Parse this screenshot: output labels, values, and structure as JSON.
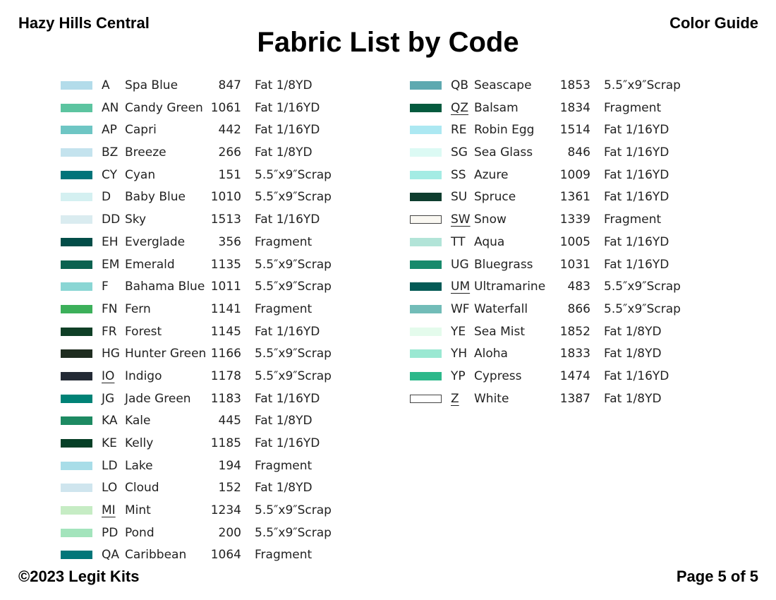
{
  "header": {
    "left": "Hazy Hills Central",
    "right": "Color Guide",
    "title": "Fabric List by Code"
  },
  "footer": {
    "left": "©2023 Legit Kits",
    "right": "Page 5 of 5"
  },
  "columns": [
    [
      {
        "code": "A",
        "name": "Spa Blue",
        "number": "847",
        "cut": "Fat 1/8YD",
        "color": "#b3dcea",
        "underline": false,
        "outline": false
      },
      {
        "code": "AN",
        "name": "Candy Green",
        "number": "1061",
        "cut": "Fat 1/16YD",
        "color": "#5cc4a0",
        "underline": false,
        "outline": false
      },
      {
        "code": "AP",
        "name": "Capri",
        "number": "442",
        "cut": "Fat 1/16YD",
        "color": "#6ec6c4",
        "underline": false,
        "outline": false
      },
      {
        "code": "BZ",
        "name": "Breeze",
        "number": "266",
        "cut": "Fat 1/8YD",
        "color": "#c4e3ee",
        "underline": false,
        "outline": false
      },
      {
        "code": "CY",
        "name": "Cyan",
        "number": "151",
        "cut": "5.5″x9″Scrap",
        "color": "#01747a",
        "underline": false,
        "outline": false
      },
      {
        "code": "D",
        "name": "Baby Blue",
        "number": "1010",
        "cut": "5.5″x9″Scrap",
        "color": "#d4f0f1",
        "underline": false,
        "outline": false
      },
      {
        "code": "DD",
        "name": "Sky",
        "number": "1513",
        "cut": "Fat 1/16YD",
        "color": "#daecf0",
        "underline": false,
        "outline": false
      },
      {
        "code": "EH",
        "name": "Everglade",
        "number": "356",
        "cut": "Fragment",
        "color": "#034d48",
        "underline": false,
        "outline": false
      },
      {
        "code": "EM",
        "name": "Emerald",
        "number": "1135",
        "cut": "5.5″x9″Scrap",
        "color": "#0b6250",
        "underline": false,
        "outline": false
      },
      {
        "code": "F",
        "name": "Bahama Blue",
        "number": "1011",
        "cut": "5.5″x9″Scrap",
        "color": "#8ad6d4",
        "underline": false,
        "outline": false
      },
      {
        "code": "FN",
        "name": "Fern",
        "number": "1141",
        "cut": "Fragment",
        "color": "#3cb05a",
        "underline": false,
        "outline": false
      },
      {
        "code": "FR",
        "name": "Forest",
        "number": "1145",
        "cut": "Fat 1/16YD",
        "color": "#0f3f26",
        "underline": false,
        "outline": false
      },
      {
        "code": "HG",
        "name": "Hunter Green",
        "number": "1166",
        "cut": "5.5″x9″Scrap",
        "color": "#1f2d20",
        "underline": false,
        "outline": false
      },
      {
        "code": "IO",
        "name": "Indigo",
        "number": "1178",
        "cut": "5.5″x9″Scrap",
        "color": "#232a35",
        "underline": true,
        "outline": false
      },
      {
        "code": "JG",
        "name": "Jade Green",
        "number": "1183",
        "cut": "Fat 1/16YD",
        "color": "#008276",
        "underline": false,
        "outline": false
      },
      {
        "code": "KA",
        "name": "Kale",
        "number": "445",
        "cut": "Fat 1/8YD",
        "color": "#1d8a62",
        "underline": false,
        "outline": false
      },
      {
        "code": "KE",
        "name": "Kelly",
        "number": "1185",
        "cut": "Fat 1/16YD",
        "color": "#053f26",
        "underline": false,
        "outline": false
      },
      {
        "code": "LD",
        "name": "Lake",
        "number": "194",
        "cut": "Fragment",
        "color": "#a8dde8",
        "underline": false,
        "outline": false
      },
      {
        "code": "LO",
        "name": "Cloud",
        "number": "152",
        "cut": "Fat 1/8YD",
        "color": "#cfe5ee",
        "underline": false,
        "outline": false
      },
      {
        "code": "MI",
        "name": "Mint",
        "number": "1234",
        "cut": "5.5″x9″Scrap",
        "color": "#c6ecc4",
        "underline": true,
        "outline": false
      },
      {
        "code": "PD",
        "name": "Pond",
        "number": "200",
        "cut": "5.5″x9″Scrap",
        "color": "#a3e4bc",
        "underline": false,
        "outline": false
      },
      {
        "code": "QA",
        "name": "Caribbean",
        "number": "1064",
        "cut": "Fragment",
        "color": "#027679",
        "underline": false,
        "outline": false
      }
    ],
    [
      {
        "code": "QB",
        "name": "Seascape",
        "number": "1853",
        "cut": "5.5″x9″Scrap",
        "color": "#5ea9b0",
        "underline": false,
        "outline": false
      },
      {
        "code": "QZ",
        "name": "Balsam",
        "number": "1834",
        "cut": "Fragment",
        "color": "#045a3e",
        "underline": true,
        "outline": false
      },
      {
        "code": "RE",
        "name": "Robin Egg",
        "number": "1514",
        "cut": "Fat 1/16YD",
        "color": "#ace8f2",
        "underline": false,
        "outline": false
      },
      {
        "code": "SG",
        "name": "Sea Glass",
        "number": "846",
        "cut": "Fat 1/16YD",
        "color": "#dcfaf4",
        "underline": false,
        "outline": false
      },
      {
        "code": "SS",
        "name": "Azure",
        "number": "1009",
        "cut": "Fat 1/16YD",
        "color": "#a4ece4",
        "underline": false,
        "outline": false
      },
      {
        "code": "SU",
        "name": "Spruce",
        "number": "1361",
        "cut": "Fat 1/16YD",
        "color": "#0e3d2e",
        "underline": false,
        "outline": false
      },
      {
        "code": "SW",
        "name": "Snow",
        "number": "1339",
        "cut": "Fragment",
        "color": "#faf8f2",
        "underline": true,
        "outline": true
      },
      {
        "code": "TT",
        "name": "Aqua",
        "number": "1005",
        "cut": "Fat 1/16YD",
        "color": "#b2e4d8",
        "underline": false,
        "outline": false
      },
      {
        "code": "UG",
        "name": "Bluegrass",
        "number": "1031",
        "cut": "Fat 1/16YD",
        "color": "#188a6c",
        "underline": false,
        "outline": false
      },
      {
        "code": "UM",
        "name": "Ultramarine",
        "number": "483",
        "cut": "5.5″x9″Scrap",
        "color": "#045a56",
        "underline": true,
        "outline": false
      },
      {
        "code": "WF",
        "name": "Waterfall",
        "number": "866",
        "cut": "5.5″x9″Scrap",
        "color": "#72bcb8",
        "underline": false,
        "outline": false
      },
      {
        "code": "YE",
        "name": "Sea Mist",
        "number": "1852",
        "cut": "Fat 1/8YD",
        "color": "#e4fbec",
        "underline": false,
        "outline": false
      },
      {
        "code": "YH",
        "name": "Aloha",
        "number": "1833",
        "cut": "Fat 1/8YD",
        "color": "#9ae8d2",
        "underline": false,
        "outline": false
      },
      {
        "code": "YP",
        "name": "Cypress",
        "number": "1474",
        "cut": "Fat 1/16YD",
        "color": "#2cb88a",
        "underline": false,
        "outline": false
      },
      {
        "code": "Z",
        "name": "White",
        "number": "1387",
        "cut": "Fat 1/8YD",
        "color": "#ffffff",
        "underline": true,
        "outline": true
      }
    ]
  ]
}
